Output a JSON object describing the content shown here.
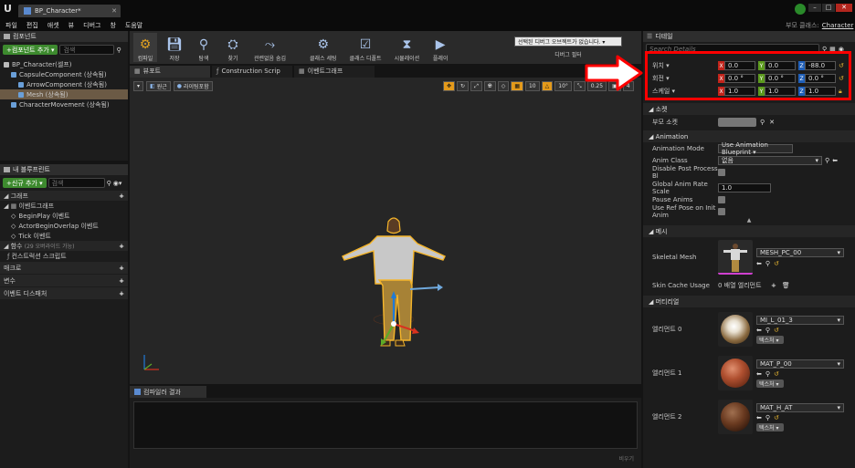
{
  "window": {
    "tab_title": "BP_Character*",
    "parent_class_label": "부모 클래스:",
    "parent_class_value": "Character"
  },
  "menu": [
    "파일",
    "편집",
    "애셋",
    "뷰",
    "디버그",
    "창",
    "도움말"
  ],
  "components": {
    "title": "컴포넌트",
    "add_button": "+컴포넌트 추가 ▾",
    "search_placeholder": "검색",
    "items": [
      {
        "label": "BP_Character(셀프)",
        "indent": 0
      },
      {
        "label": "CapsuleComponent (상속됨)",
        "indent": 1
      },
      {
        "label": "ArrowComponent (상속됨)",
        "indent": 2
      },
      {
        "label": "Mesh (상속됨)",
        "indent": 2,
        "selected": true
      },
      {
        "label": "CharacterMovement (상속됨)",
        "indent": 1
      }
    ]
  },
  "toolbar": {
    "buttons": [
      "컴파일",
      "저장",
      "탐색",
      "찾기",
      "관련없음 숨김",
      "클래스 세팅",
      "클래스 디폴트",
      "시뮬레이션",
      "플레이"
    ],
    "debug_select": "선택된 디버그 오브젝트가 없습니다. ▾",
    "debug_filter": "디버그 필터"
  },
  "viewport_tabs": [
    "뷰포트",
    "Construction Scrip",
    "이벤트그래프"
  ],
  "viewport": {
    "perspective": "원근",
    "lighting": "라이팅포함",
    "snap_grid": "10",
    "snap_rot": "10°",
    "snap_scale": "0.25",
    "cam_speed": "4"
  },
  "my_blueprint": {
    "title": "내 블루프린트",
    "add_button": "+신규 추가 ▾",
    "search_placeholder": "검색",
    "graph_section": "그래프",
    "event_graph": "이벤트그래프",
    "events": [
      "BeginPlay 이벤트",
      "ActorBeginOverlap 이벤트",
      "Tick 이벤트"
    ],
    "functions_section": "함수",
    "functions_override": "(29 오버라이드 가능)",
    "construction_script": "컨스트럭션 스크립트",
    "macros": "매크로",
    "variables": "변수",
    "dispatchers": "이벤트 디스패처"
  },
  "compiler": {
    "tab": "컴파일러 결과",
    "clear": "비우기"
  },
  "details": {
    "title": "디테일",
    "search_placeholder": "Search Details",
    "transform": {
      "location": {
        "label": "위치 ▾",
        "x": "0.0",
        "y": "0.0",
        "z": "-88.0"
      },
      "rotation": {
        "label": "회전 ▾",
        "x": "0.0 °",
        "y": "0.0 °",
        "z": "0.0 °"
      },
      "scale": {
        "label": "스케일 ▾",
        "x": "1.0",
        "y": "1.0",
        "z": "1.0"
      }
    },
    "socket": {
      "section": "소켓",
      "parent_socket": "부모 소켓"
    },
    "animation": {
      "section": "Animation",
      "mode_label": "Animation Mode",
      "mode_value": "Use Animation Blueprint ▾",
      "class_label": "Anim Class",
      "class_value": "없음",
      "disable_pp": "Disable Post Process Bl",
      "global_rate_label": "Global Anim Rate Scale",
      "global_rate_value": "1.0",
      "pause": "Pause Anims",
      "use_ref_pose": "Use Ref Pose on Init Anim"
    },
    "mesh": {
      "section": "메시",
      "skeletal_label": "Skeletal Mesh",
      "skeletal_value": "MESH_PC_00",
      "skin_cache_label": "Skin Cache Usage",
      "skin_cache_value": "0 배열 엘리먼트"
    },
    "materials": {
      "section": "머티리얼",
      "texture_btn": "텍스처 ▾",
      "elements": [
        {
          "label": "엘리먼트 0",
          "value": "MI_L_01_3"
        },
        {
          "label": "엘리먼트 1",
          "value": "MAT_P_00"
        },
        {
          "label": "엘리먼트 2",
          "value": "MAT_H_AT"
        }
      ]
    }
  },
  "colors": {
    "highlight_box": "#ff0000",
    "arrow": "#ffffff",
    "accent_green": "#3d8a2e",
    "selected_row": "#6b5a45"
  }
}
